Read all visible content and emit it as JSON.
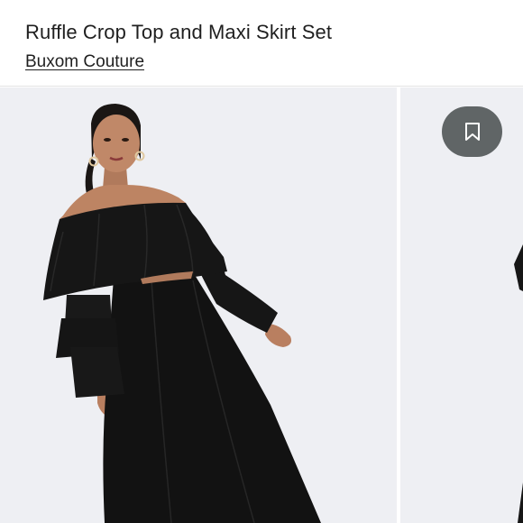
{
  "listing": {
    "title": "Ruffle Crop Top and Maxi Skirt Set",
    "brand": "Buxom Couture"
  },
  "gallery": {
    "images": [
      {
        "alt": "Model wearing black off-shoulder ruffle crop top and black maxi skirt"
      },
      {
        "alt": "Second product photo"
      }
    ],
    "save_icon": "bookmark-icon"
  },
  "colors": {
    "background": "#eeeff3",
    "garment": "#141414",
    "save_button": "#606566"
  }
}
